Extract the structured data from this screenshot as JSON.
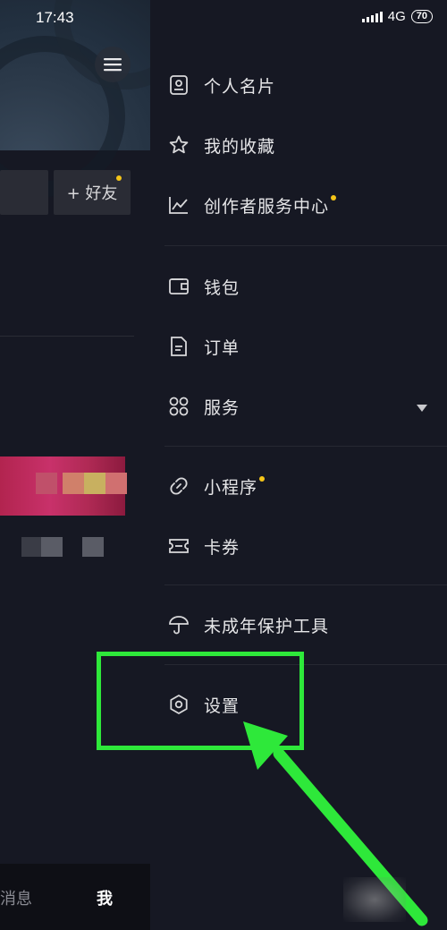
{
  "status_bar": {
    "time": "17:43",
    "network": "4G",
    "battery": "70"
  },
  "background_page": {
    "add_friend_label": "+ 好友",
    "tabs": [
      {
        "label": "消息"
      },
      {
        "label": "我"
      }
    ]
  },
  "drawer": {
    "groups": [
      {
        "items": [
          {
            "label": "个人名片",
            "icon": "contact-card-icon"
          },
          {
            "label": "我的收藏",
            "icon": "star-icon"
          },
          {
            "label": "创作者服务中心",
            "icon": "line-chart-icon",
            "badge": true
          }
        ]
      },
      {
        "items": [
          {
            "label": "钱包",
            "icon": "wallet-icon"
          },
          {
            "label": "订单",
            "icon": "document-icon"
          },
          {
            "label": "服务",
            "icon": "grid-icon",
            "expandable": true
          }
        ]
      },
      {
        "items": [
          {
            "label": "小程序",
            "icon": "link-icon",
            "badge": true
          },
          {
            "label": "卡券",
            "icon": "ticket-icon"
          }
        ]
      },
      {
        "items": [
          {
            "label": "未成年保护工具",
            "icon": "umbrella-icon"
          }
        ]
      },
      {
        "items": [
          {
            "label": "设置",
            "icon": "gear-icon"
          }
        ]
      }
    ]
  },
  "annotation": {
    "highlight_color": "#2ee83a",
    "badge_color": "#f5c518"
  }
}
